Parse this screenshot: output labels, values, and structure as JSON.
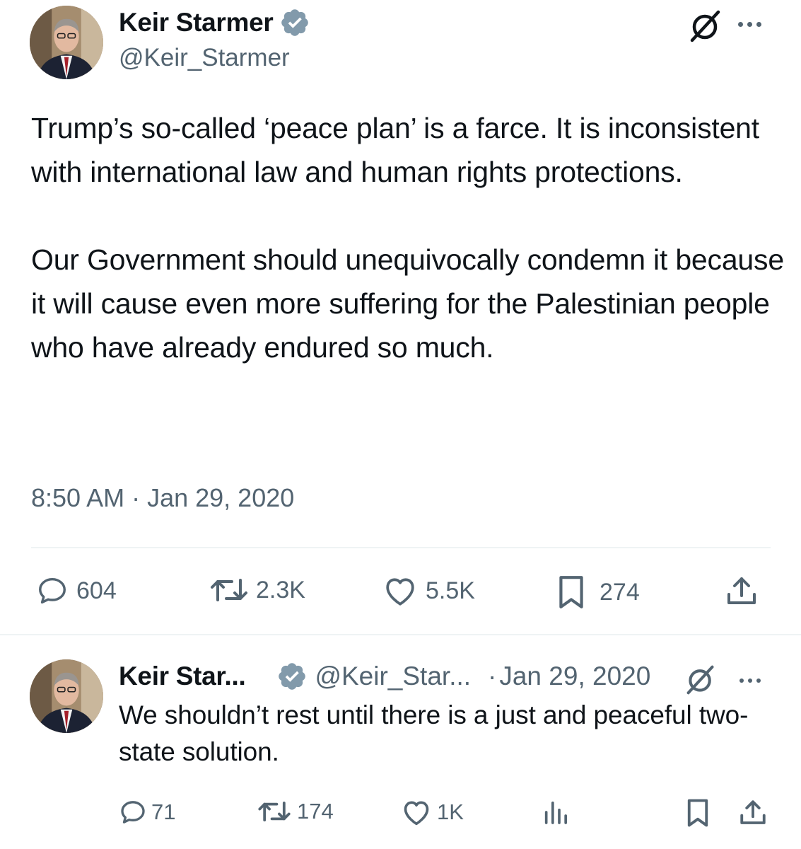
{
  "main_tweet": {
    "author_name": "Keir Starmer",
    "handle": "@Keir_Starmer",
    "text": "Trump’s so-called ‘peace plan’ is a farce. It is inconsistent with international law and human rights protections.\n\nOur Government should unequivocally condemn it because it will cause even more suffering for the Palestinian people who have already endured so much.",
    "timestamp": "8:50 AM · Jan 29, 2020",
    "stats": {
      "replies": "604",
      "reposts": "2.3K",
      "likes": "5.5K",
      "bookmarks": "274"
    }
  },
  "reply_tweet": {
    "author_name": "Keir Star...",
    "handle": "@Keir_Star...",
    "separator": "·",
    "date": "Jan 29, 2020",
    "text": "We shouldn’t rest until there is a just and peaceful two-state solution.",
    "stats": {
      "replies": "71",
      "reposts": "174",
      "likes": "1K"
    }
  },
  "icons": {
    "verified": "verified-badge-icon",
    "grok": "grok-icon",
    "more": "more-icon",
    "reply": "reply-icon",
    "repost": "repost-icon",
    "like": "like-icon",
    "bookmark": "bookmark-icon",
    "share": "share-icon",
    "views": "views-icon"
  },
  "colors": {
    "text_primary": "#0f1419",
    "text_secondary": "#536471",
    "verified_badge": "#829aab",
    "divider": "#eff3f4"
  }
}
